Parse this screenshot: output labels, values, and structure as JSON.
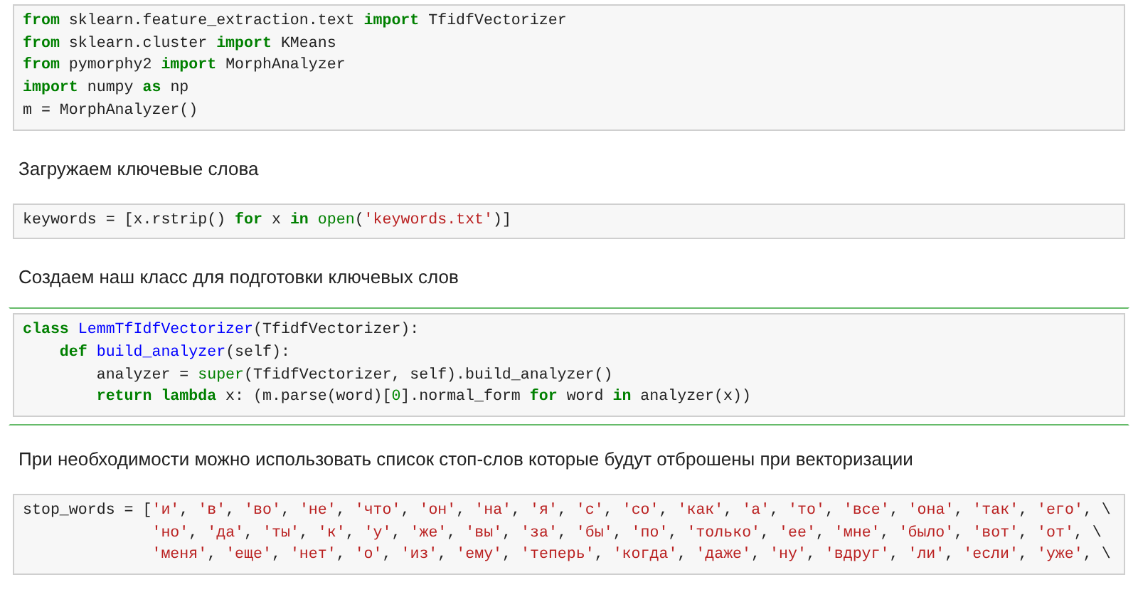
{
  "cells": [
    {
      "kind": "code",
      "selected": false,
      "lines": [
        [
          {
            "kind": "keyword",
            "text": "from"
          },
          {
            "kind": "plain",
            "text": " sklearn.feature_extraction.text "
          },
          {
            "kind": "keyword",
            "text": "import"
          },
          {
            "kind": "plain",
            "text": " TfidfVectorizer"
          }
        ],
        [
          {
            "kind": "keyword",
            "text": "from"
          },
          {
            "kind": "plain",
            "text": " sklearn.cluster "
          },
          {
            "kind": "keyword",
            "text": "import"
          },
          {
            "kind": "plain",
            "text": " KMeans"
          }
        ],
        [
          {
            "kind": "keyword",
            "text": "from"
          },
          {
            "kind": "plain",
            "text": " pymorphy2 "
          },
          {
            "kind": "keyword",
            "text": "import"
          },
          {
            "kind": "plain",
            "text": " MorphAnalyzer"
          }
        ],
        [
          {
            "kind": "keyword",
            "text": "import"
          },
          {
            "kind": "plain",
            "text": " numpy "
          },
          {
            "kind": "keyword",
            "text": "as"
          },
          {
            "kind": "plain",
            "text": " np"
          }
        ],
        [
          {
            "kind": "plain",
            "text": "m = MorphAnalyzer()"
          }
        ]
      ]
    },
    {
      "kind": "markdown",
      "selected": false,
      "text": "Загружаем ключевые слова"
    },
    {
      "kind": "code",
      "selected": false,
      "lines": [
        [
          {
            "kind": "plain",
            "text": "keywords = [x.rstrip() "
          },
          {
            "kind": "keyword",
            "text": "for"
          },
          {
            "kind": "plain",
            "text": " x "
          },
          {
            "kind": "keyword",
            "text": "in"
          },
          {
            "kind": "builtin",
            "text": " open"
          },
          {
            "kind": "plain",
            "text": "("
          },
          {
            "kind": "string",
            "text": "'keywords.txt'"
          },
          {
            "kind": "plain",
            "text": ")]"
          }
        ]
      ]
    },
    {
      "kind": "markdown",
      "selected": false,
      "text": "Создаем наш класс для подготовки ключевых слов"
    },
    {
      "kind": "code",
      "selected": true,
      "lines": [
        [
          {
            "kind": "keyword",
            "text": "class"
          },
          {
            "kind": "name",
            "text": " LemmTfIdfVectorizer"
          },
          {
            "kind": "plain",
            "text": "(TfidfVectorizer):"
          }
        ],
        [
          {
            "kind": "keyword",
            "text": "    def"
          },
          {
            "kind": "name",
            "text": " build_analyzer"
          },
          {
            "kind": "plain",
            "text": "(self):"
          }
        ],
        [
          {
            "kind": "plain",
            "text": "        analyzer = "
          },
          {
            "kind": "builtin",
            "text": "super"
          },
          {
            "kind": "plain",
            "text": "(TfidfVectorizer, self).build_analyzer()"
          }
        ],
        [
          {
            "kind": "keyword",
            "text": "        return"
          },
          {
            "kind": "keyword",
            "text": " lambda"
          },
          {
            "kind": "plain",
            "text": " x: (m.parse(word)["
          },
          {
            "kind": "number",
            "text": "0"
          },
          {
            "kind": "plain",
            "text": "].normal_form "
          },
          {
            "kind": "keyword",
            "text": "for"
          },
          {
            "kind": "plain",
            "text": " word "
          },
          {
            "kind": "keyword",
            "text": "in"
          },
          {
            "kind": "plain",
            "text": " analyzer(x))"
          }
        ]
      ]
    },
    {
      "kind": "markdown",
      "selected": false,
      "text": "При необходимости можно использовать список стоп-слов которые будут отброшены при векторизации"
    },
    {
      "kind": "code",
      "selected": false,
      "lines": [
        [
          {
            "kind": "plain",
            "text": "stop_words = ["
          },
          {
            "kind": "string",
            "text": "'и'"
          },
          {
            "kind": "plain",
            "text": ", "
          },
          {
            "kind": "string",
            "text": "'в'"
          },
          {
            "kind": "plain",
            "text": ", "
          },
          {
            "kind": "string",
            "text": "'во'"
          },
          {
            "kind": "plain",
            "text": ", "
          },
          {
            "kind": "string",
            "text": "'не'"
          },
          {
            "kind": "plain",
            "text": ", "
          },
          {
            "kind": "string",
            "text": "'что'"
          },
          {
            "kind": "plain",
            "text": ", "
          },
          {
            "kind": "string",
            "text": "'он'"
          },
          {
            "kind": "plain",
            "text": ", "
          },
          {
            "kind": "string",
            "text": "'на'"
          },
          {
            "kind": "plain",
            "text": ", "
          },
          {
            "kind": "string",
            "text": "'я'"
          },
          {
            "kind": "plain",
            "text": ", "
          },
          {
            "kind": "string",
            "text": "'с'"
          },
          {
            "kind": "plain",
            "text": ", "
          },
          {
            "kind": "string",
            "text": "'со'"
          },
          {
            "kind": "plain",
            "text": ", "
          },
          {
            "kind": "string",
            "text": "'как'"
          },
          {
            "kind": "plain",
            "text": ", "
          },
          {
            "kind": "string",
            "text": "'а'"
          },
          {
            "kind": "plain",
            "text": ", "
          },
          {
            "kind": "string",
            "text": "'то'"
          },
          {
            "kind": "plain",
            "text": ", "
          },
          {
            "kind": "string",
            "text": "'все'"
          },
          {
            "kind": "plain",
            "text": ", "
          },
          {
            "kind": "string",
            "text": "'она'"
          },
          {
            "kind": "plain",
            "text": ", "
          },
          {
            "kind": "string",
            "text": "'так'"
          },
          {
            "kind": "plain",
            "text": ", "
          },
          {
            "kind": "string",
            "text": "'его'"
          },
          {
            "kind": "plain",
            "text": ", \\"
          }
        ],
        [
          {
            "kind": "string",
            "text": "              'но'"
          },
          {
            "kind": "plain",
            "text": ", "
          },
          {
            "kind": "string",
            "text": "'да'"
          },
          {
            "kind": "plain",
            "text": ", "
          },
          {
            "kind": "string",
            "text": "'ты'"
          },
          {
            "kind": "plain",
            "text": ", "
          },
          {
            "kind": "string",
            "text": "'к'"
          },
          {
            "kind": "plain",
            "text": ", "
          },
          {
            "kind": "string",
            "text": "'у'"
          },
          {
            "kind": "plain",
            "text": ", "
          },
          {
            "kind": "string",
            "text": "'же'"
          },
          {
            "kind": "plain",
            "text": ", "
          },
          {
            "kind": "string",
            "text": "'вы'"
          },
          {
            "kind": "plain",
            "text": ", "
          },
          {
            "kind": "string",
            "text": "'за'"
          },
          {
            "kind": "plain",
            "text": ", "
          },
          {
            "kind": "string",
            "text": "'бы'"
          },
          {
            "kind": "plain",
            "text": ", "
          },
          {
            "kind": "string",
            "text": "'по'"
          },
          {
            "kind": "plain",
            "text": ", "
          },
          {
            "kind": "string",
            "text": "'только'"
          },
          {
            "kind": "plain",
            "text": ", "
          },
          {
            "kind": "string",
            "text": "'ее'"
          },
          {
            "kind": "plain",
            "text": ", "
          },
          {
            "kind": "string",
            "text": "'мне'"
          },
          {
            "kind": "plain",
            "text": ", "
          },
          {
            "kind": "string",
            "text": "'было'"
          },
          {
            "kind": "plain",
            "text": ", "
          },
          {
            "kind": "string",
            "text": "'вот'"
          },
          {
            "kind": "plain",
            "text": ", "
          },
          {
            "kind": "string",
            "text": "'от'"
          },
          {
            "kind": "plain",
            "text": ", \\"
          }
        ],
        [
          {
            "kind": "string",
            "text": "              'меня'"
          },
          {
            "kind": "plain",
            "text": ", "
          },
          {
            "kind": "string",
            "text": "'еще'"
          },
          {
            "kind": "plain",
            "text": ", "
          },
          {
            "kind": "string",
            "text": "'нет'"
          },
          {
            "kind": "plain",
            "text": ", "
          },
          {
            "kind": "string",
            "text": "'о'"
          },
          {
            "kind": "plain",
            "text": ", "
          },
          {
            "kind": "string",
            "text": "'из'"
          },
          {
            "kind": "plain",
            "text": ", "
          },
          {
            "kind": "string",
            "text": "'ему'"
          },
          {
            "kind": "plain",
            "text": ", "
          },
          {
            "kind": "string",
            "text": "'теперь'"
          },
          {
            "kind": "plain",
            "text": ", "
          },
          {
            "kind": "string",
            "text": "'когда'"
          },
          {
            "kind": "plain",
            "text": ", "
          },
          {
            "kind": "string",
            "text": "'даже'"
          },
          {
            "kind": "plain",
            "text": ", "
          },
          {
            "kind": "string",
            "text": "'ну'"
          },
          {
            "kind": "plain",
            "text": ", "
          },
          {
            "kind": "string",
            "text": "'вдруг'"
          },
          {
            "kind": "plain",
            "text": ", "
          },
          {
            "kind": "string",
            "text": "'ли'"
          },
          {
            "kind": "plain",
            "text": ", "
          },
          {
            "kind": "string",
            "text": "'если'"
          },
          {
            "kind": "plain",
            "text": ", "
          },
          {
            "kind": "string",
            "text": "'уже'"
          },
          {
            "kind": "plain",
            "text": ", \\"
          }
        ]
      ]
    }
  ]
}
